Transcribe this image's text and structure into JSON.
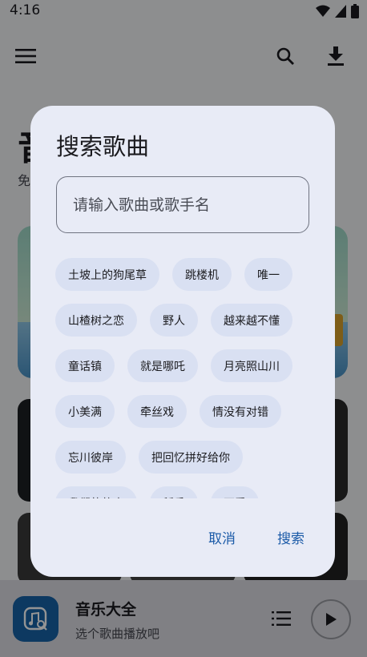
{
  "status": {
    "time": "4:16"
  },
  "header": {
    "menu_icon": "menu-icon",
    "search_icon": "search-icon",
    "download_icon": "download-icon"
  },
  "page": {
    "title": "音",
    "subtitle": "免"
  },
  "player": {
    "title": "音乐大全",
    "subtitle": "选个歌曲播放吧",
    "art_icon": "music-search-icon",
    "queue_icon": "queue-list-icon",
    "play_icon": "play-icon"
  },
  "dialog": {
    "title": "搜索歌曲",
    "search_placeholder": "请输入歌曲或歌手名",
    "chip_rows": [
      [
        "土坡上的狗尾草",
        "跳楼机",
        "唯一"
      ],
      [
        "山楂树之恋",
        "野人",
        "越来越不懂"
      ],
      [
        "童话镇",
        "就是哪吒",
        "月亮照山川"
      ],
      [
        "小美满",
        "牵丝戏",
        "情没有对错"
      ],
      [
        "忘川彼岸",
        "把回忆拼好给你"
      ],
      [
        "我们的故事",
        "稻香",
        "不爱"
      ]
    ],
    "cancel_label": "取消",
    "confirm_label": "搜索"
  },
  "colors": {
    "accent": "#1c5ba8",
    "dialog_bg": "#e8ebf6",
    "chip_bg": "#d9e0f2"
  }
}
